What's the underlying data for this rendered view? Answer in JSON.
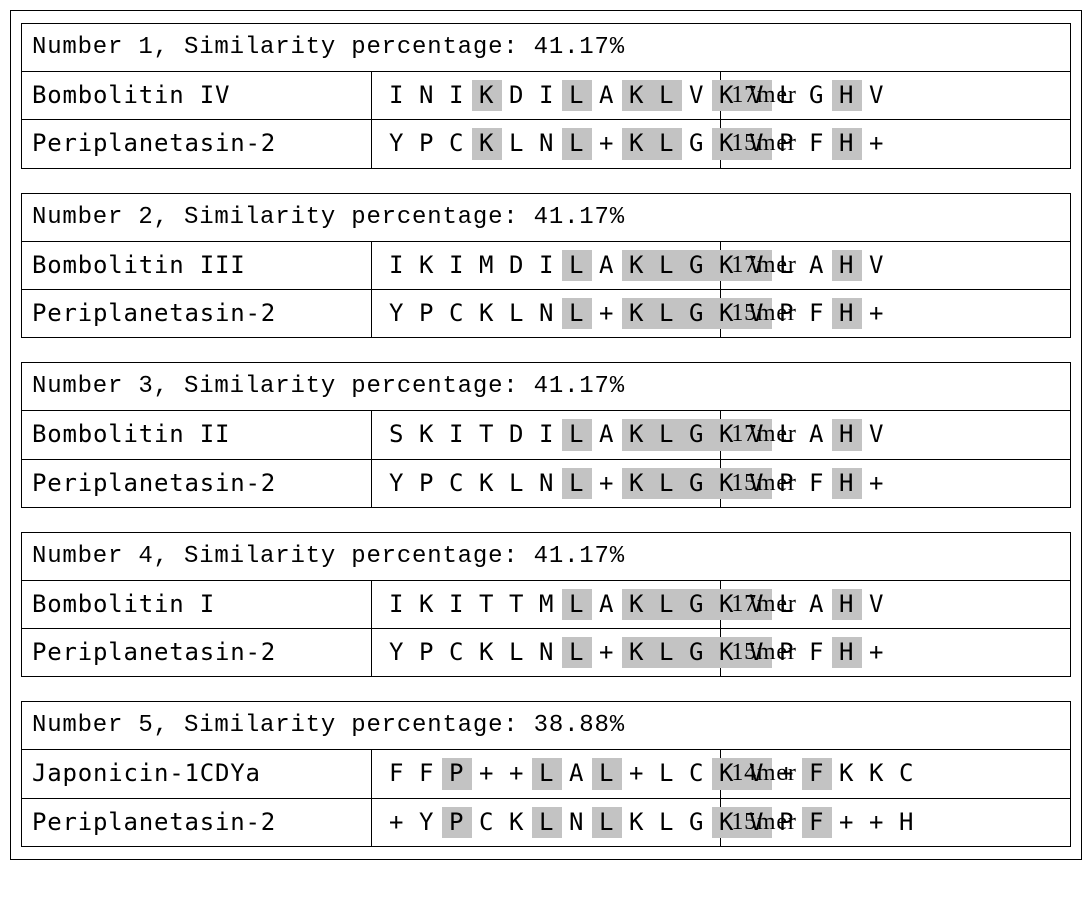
{
  "blocks": [
    {
      "header": "Number 1, Similarity percentage: 41.17%",
      "rows": [
        {
          "name": "Bombolitin IV",
          "seq": [
            "I",
            "N",
            "I",
            "K",
            "D",
            "I",
            "L",
            "A",
            "K",
            "L",
            "V",
            "K",
            "V",
            "L",
            "G",
            "H",
            "V"
          ],
          "hl": [
            0,
            0,
            0,
            1,
            0,
            0,
            1,
            0,
            1,
            1,
            0,
            1,
            1,
            0,
            0,
            1,
            0
          ],
          "len": "17mer"
        },
        {
          "name": "Periplanetasin-2",
          "seq": [
            "Y",
            "P",
            "C",
            "K",
            "L",
            "N",
            "L",
            "+",
            "K",
            "L",
            "G",
            "K",
            "V",
            "P",
            "F",
            "H",
            "+"
          ],
          "hl": [
            0,
            0,
            0,
            1,
            0,
            0,
            1,
            0,
            1,
            1,
            0,
            1,
            1,
            0,
            0,
            1,
            0
          ],
          "len": "15mer"
        }
      ]
    },
    {
      "header": "Number 2, Similarity percentage: 41.17%",
      "rows": [
        {
          "name": "Bombolitin III",
          "seq": [
            "I",
            "K",
            "I",
            "M",
            "D",
            "I",
            "L",
            "A",
            "K",
            "L",
            "G",
            "K",
            "V",
            "L",
            "A",
            "H",
            "V"
          ],
          "hl": [
            0,
            0,
            0,
            0,
            0,
            0,
            1,
            0,
            1,
            1,
            1,
            1,
            1,
            0,
            0,
            1,
            0
          ],
          "len": "17mer"
        },
        {
          "name": "Periplanetasin-2",
          "seq": [
            "Y",
            "P",
            "C",
            "K",
            "L",
            "N",
            "L",
            "+",
            "K",
            "L",
            "G",
            "K",
            "V",
            "P",
            "F",
            "H",
            "+"
          ],
          "hl": [
            0,
            0,
            0,
            0,
            0,
            0,
            1,
            0,
            1,
            1,
            1,
            1,
            1,
            0,
            0,
            1,
            0
          ],
          "len": "15mer"
        }
      ]
    },
    {
      "header": "Number 3, Similarity percentage: 41.17%",
      "rows": [
        {
          "name": "Bombolitin II",
          "seq": [
            "S",
            "K",
            "I",
            "T",
            "D",
            "I",
            "L",
            "A",
            "K",
            "L",
            "G",
            "K",
            "V",
            "L",
            "A",
            "H",
            "V"
          ],
          "hl": [
            0,
            0,
            0,
            0,
            0,
            0,
            1,
            0,
            1,
            1,
            1,
            1,
            1,
            0,
            0,
            1,
            0
          ],
          "len": "17mer"
        },
        {
          "name": "Periplanetasin-2",
          "seq": [
            "Y",
            "P",
            "C",
            "K",
            "L",
            "N",
            "L",
            "+",
            "K",
            "L",
            "G",
            "K",
            "V",
            "P",
            "F",
            "H",
            "+"
          ],
          "hl": [
            0,
            0,
            0,
            0,
            0,
            0,
            1,
            0,
            1,
            1,
            1,
            1,
            1,
            0,
            0,
            1,
            0
          ],
          "len": "15mer"
        }
      ]
    },
    {
      "header": "Number 4, Similarity percentage: 41.17%",
      "rows": [
        {
          "name": "Bombolitin I",
          "seq": [
            "I",
            "K",
            "I",
            "T",
            "T",
            "M",
            "L",
            "A",
            "K",
            "L",
            "G",
            "K",
            "V",
            "L",
            "A",
            "H",
            "V"
          ],
          "hl": [
            0,
            0,
            0,
            0,
            0,
            0,
            1,
            0,
            1,
            1,
            1,
            1,
            1,
            0,
            0,
            1,
            0
          ],
          "len": "17mer"
        },
        {
          "name": "Periplanetasin-2",
          "seq": [
            "Y",
            "P",
            "C",
            "K",
            "L",
            "N",
            "L",
            "+",
            "K",
            "L",
            "G",
            "K",
            "V",
            "P",
            "F",
            "H",
            "+"
          ],
          "hl": [
            0,
            0,
            0,
            0,
            0,
            0,
            1,
            0,
            1,
            1,
            1,
            1,
            1,
            0,
            0,
            1,
            0
          ],
          "len": "15mer"
        }
      ]
    },
    {
      "header": "Number 5, Similarity percentage: 38.88%",
      "rows": [
        {
          "name": "Japonicin-1CDYa",
          "seq": [
            "F",
            "F",
            "P",
            "+",
            "+",
            "L",
            "A",
            "L",
            "+",
            "L",
            "C",
            "K",
            "V",
            "+",
            "F",
            "K",
            "K",
            "C"
          ],
          "hl": [
            0,
            0,
            1,
            0,
            0,
            1,
            0,
            1,
            0,
            0,
            0,
            1,
            1,
            0,
            1,
            0,
            0,
            0
          ],
          "len": "14mer"
        },
        {
          "name": "Periplanetasin-2",
          "seq": [
            "+",
            "Y",
            "P",
            "C",
            "K",
            "L",
            "N",
            "L",
            "K",
            "L",
            "G",
            "K",
            "V",
            "P",
            "F",
            "+",
            "+",
            "H"
          ],
          "hl": [
            0,
            0,
            1,
            0,
            0,
            1,
            0,
            1,
            0,
            0,
            0,
            1,
            1,
            0,
            1,
            0,
            0,
            0
          ],
          "len": "15mer"
        }
      ]
    }
  ]
}
